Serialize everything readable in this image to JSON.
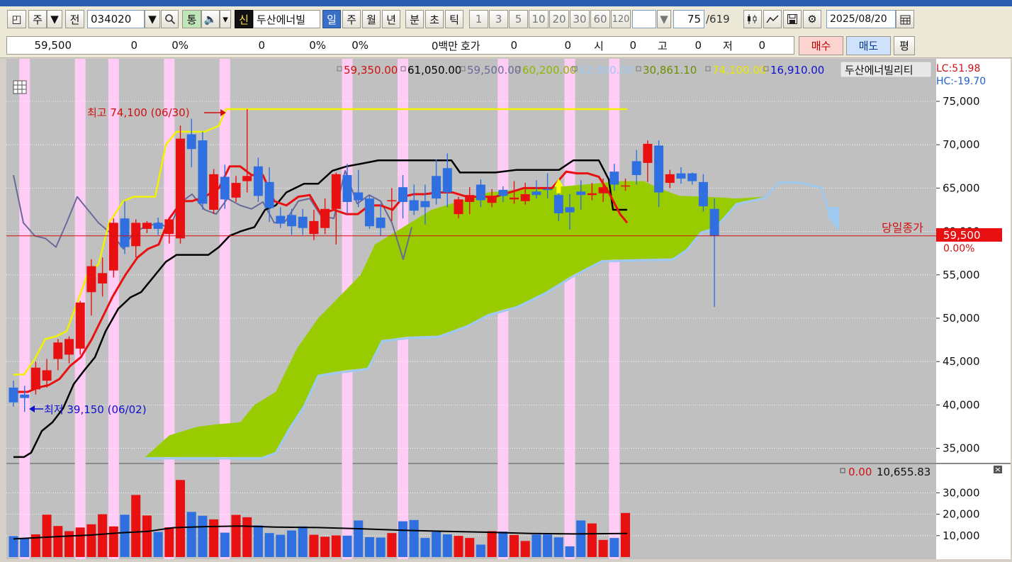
{
  "toolbar": {
    "period_unit": "주",
    "prev_label": "전",
    "stock_code": "034020",
    "ton_label": "통",
    "new_label": "신",
    "stock_name": "두산에너빌",
    "tabs": [
      "일",
      "주",
      "월",
      "년",
      "분",
      "초",
      "틱"
    ],
    "selected_tab": "일",
    "intervals": [
      "1",
      "3",
      "5",
      "10",
      "20",
      "30",
      "60",
      "120"
    ],
    "count_current": "75",
    "count_total": "/619",
    "date": "2025/08/20"
  },
  "quote": {
    "price": "59,500",
    "change": "0",
    "change_pct": "0%",
    "vol": "0",
    "vol_pct": "0%",
    "pct3": "0%",
    "amount": "0백만",
    "hoga_label": "호가",
    "hoga_val": "0",
    "val2": "0",
    "open_label": "시",
    "open_val": "0",
    "high_label": "고",
    "high_val": "0",
    "low_label": "저",
    "low_val": "0",
    "buy_label": "매수",
    "sell_label": "매도",
    "eval_label": "평"
  },
  "legend": {
    "items": [
      "59,350.00",
      "61,050.00",
      "59,500.00",
      "60,200.00",
      "62,800.00",
      "30,861.10",
      "74,100.00",
      "16,910.00"
    ],
    "colors": [
      "#d01010",
      "#000000",
      "#6a6a9a",
      "#8ab800",
      "#9ec9f0",
      "#6a8f00",
      "#e8e800",
      "#1010d0"
    ],
    "stock": "두산에너빌리티",
    "lc": "LC:51.98",
    "hc": "HC:-19.70"
  },
  "annotations": {
    "high": "최고 74,100 (06/30)",
    "low": "최저 39,150 (06/02)",
    "close_label": "당일종가",
    "close_price": "59,500",
    "close_pct": "0.00%"
  },
  "volume_legend": {
    "v1": "0.00",
    "v2": "10,655.83"
  },
  "colors": {
    "up": "#e81010",
    "down": "#2f6fe0",
    "highlight": "#ffccf5",
    "panel": "#c0c0c0",
    "cloud": "#99cc00"
  },
  "chart_data": [
    {
      "type": "candlestick",
      "series": [
        {
          "name": "price",
          "values": [
            {
              "o": 42,
              "h": 42.8,
              "l": 39.8,
              "c": 40.3
            },
            {
              "o": 41.2,
              "h": 42.2,
              "l": 39.2,
              "c": 40.8
            },
            {
              "o": 41.8,
              "h": 45,
              "l": 41.2,
              "c": 44.3
            },
            {
              "o": 42.8,
              "h": 45.3,
              "l": 42,
              "c": 44
            },
            {
              "o": 45.3,
              "h": 47.6,
              "l": 44,
              "c": 47.2
            },
            {
              "o": 45.8,
              "h": 47.9,
              "l": 44.8,
              "c": 47.6
            },
            {
              "o": 46.5,
              "h": 52,
              "l": 45.8,
              "c": 51.8
            },
            {
              "o": 53,
              "h": 56.8,
              "l": 50.3,
              "c": 56
            },
            {
              "o": 54,
              "h": 57,
              "l": 52.5,
              "c": 55.2
            },
            {
              "o": 55.5,
              "h": 61.5,
              "l": 54.7,
              "c": 61
            },
            {
              "o": 61.5,
              "h": 63.5,
              "l": 57.4,
              "c": 58.2
            },
            {
              "o": 58.3,
              "h": 61.4,
              "l": 57,
              "c": 61
            },
            {
              "o": 60.3,
              "h": 61.2,
              "l": 59.8,
              "c": 61
            },
            {
              "o": 61,
              "h": 61.6,
              "l": 59.6,
              "c": 60.3
            },
            {
              "o": 59.7,
              "h": 61.6,
              "l": 58.6,
              "c": 61.4
            },
            {
              "o": 59.2,
              "h": 72.2,
              "l": 58.6,
              "c": 70.7
            },
            {
              "o": 71.2,
              "h": 73,
              "l": 67.4,
              "c": 69.5
            },
            {
              "o": 70.5,
              "h": 71.5,
              "l": 62.5,
              "c": 63.2
            },
            {
              "o": 62.5,
              "h": 67.2,
              "l": 62,
              "c": 66.6
            },
            {
              "o": 66.3,
              "h": 67.7,
              "l": 62.6,
              "c": 63.7
            },
            {
              "o": 63.9,
              "h": 66.4,
              "l": 63.4,
              "c": 65.6
            },
            {
              "o": 65.8,
              "h": 74.1,
              "l": 64.5,
              "c": 66.4
            },
            {
              "o": 67.5,
              "h": 68.5,
              "l": 63.4,
              "c": 64.1
            },
            {
              "o": 65.7,
              "h": 67.4,
              "l": 61.1,
              "c": 62.7
            },
            {
              "o": 61.8,
              "h": 62.8,
              "l": 60.4,
              "c": 60.9
            },
            {
              "o": 61.9,
              "h": 62.6,
              "l": 59.6,
              "c": 60.6
            },
            {
              "o": 61.7,
              "h": 62.6,
              "l": 59.6,
              "c": 60.4
            },
            {
              "o": 59.7,
              "h": 62.5,
              "l": 59,
              "c": 61.2
            },
            {
              "o": 60.4,
              "h": 63.8,
              "l": 59.7,
              "c": 62.6
            },
            {
              "o": 62.6,
              "h": 66.8,
              "l": 58.5,
              "c": 66.6
            },
            {
              "o": 66.5,
              "h": 67.8,
              "l": 62,
              "c": 63.4
            },
            {
              "o": 64.5,
              "h": 67.1,
              "l": 62.8,
              "c": 63.6
            },
            {
              "o": 63.8,
              "h": 64.1,
              "l": 60.3,
              "c": 60.6
            },
            {
              "o": 61.6,
              "h": 63.2,
              "l": 59.5,
              "c": 60.4
            },
            {
              "o": 63.6,
              "h": 65,
              "l": 61.2,
              "c": 63.6
            },
            {
              "o": 65.1,
              "h": 66.5,
              "l": 61.5,
              "c": 63.4
            },
            {
              "o": 63.6,
              "h": 65.4,
              "l": 61.9,
              "c": 62.4
            },
            {
              "o": 63.5,
              "h": 65.4,
              "l": 60.8,
              "c": 62.8
            },
            {
              "o": 66.4,
              "h": 68.3,
              "l": 63.1,
              "c": 63.8
            },
            {
              "o": 67.3,
              "h": 69,
              "l": 62.8,
              "c": 64.5
            },
            {
              "o": 62,
              "h": 64,
              "l": 61.5,
              "c": 63.7
            },
            {
              "o": 63.4,
              "h": 65.1,
              "l": 62,
              "c": 64.2
            },
            {
              "o": 65.4,
              "h": 66,
              "l": 62.8,
              "c": 63.6
            },
            {
              "o": 63.3,
              "h": 64.9,
              "l": 62.8,
              "c": 64.1
            },
            {
              "o": 64.8,
              "h": 65.2,
              "l": 63.4,
              "c": 64.1
            },
            {
              "o": 63.7,
              "h": 65.8,
              "l": 63.2,
              "c": 63.9
            },
            {
              "o": 63.5,
              "h": 65.6,
              "l": 63.1,
              "c": 64.3
            },
            {
              "o": 64.6,
              "h": 65.9,
              "l": 63.8,
              "c": 64.2
            },
            {
              "o": 64.9,
              "h": 66.7,
              "l": 63.8,
              "c": 64.8
            },
            {
              "o": 64.2,
              "h": 65,
              "l": 61.2,
              "c": 62.1
            },
            {
              "o": 62.8,
              "h": 64.3,
              "l": 60.2,
              "c": 62.2
            },
            {
              "o": 64.6,
              "h": 65.9,
              "l": 62.5,
              "c": 64.2
            },
            {
              "o": 64.2,
              "h": 65.6,
              "l": 63.6,
              "c": 64.4
            },
            {
              "o": 64.4,
              "h": 66.1,
              "l": 63.4,
              "c": 65.1
            },
            {
              "o": 66.9,
              "h": 67.8,
              "l": 64.7,
              "c": 65.4
            },
            {
              "o": 65.2,
              "h": 66.1,
              "l": 64.7,
              "c": 65.3
            },
            {
              "o": 68.1,
              "h": 69.4,
              "l": 65.4,
              "c": 66.5
            },
            {
              "o": 67.9,
              "h": 70.5,
              "l": 65.7,
              "c": 70.1
            },
            {
              "o": 69.9,
              "h": 70.5,
              "l": 62.8,
              "c": 64.5
            },
            {
              "o": 65.6,
              "h": 67.1,
              "l": 65,
              "c": 66.6
            },
            {
              "o": 66.7,
              "h": 67.4,
              "l": 65.5,
              "c": 66.1
            },
            {
              "o": 66.7,
              "h": 66.8,
              "l": 65.4,
              "c": 65.8
            },
            {
              "o": 65.7,
              "h": 66.6,
              "l": 62.3,
              "c": 62.9
            },
            {
              "o": 62.6,
              "h": 63.8,
              "l": 51.3,
              "c": 59.5
            }
          ]
        }
      ]
    },
    {
      "type": "bar",
      "series": [
        {
          "name": "volume",
          "values": [
            9.8,
            8.8,
            10.6,
            19.8,
            14.5,
            12.1,
            13.8,
            15.3,
            20,
            14.3,
            19.8,
            29,
            19.4,
            11.7,
            13.9,
            36,
            21.1,
            19.3,
            17.6,
            11.4,
            19.7,
            18.6,
            14.8,
            11.2,
            10.4,
            12.4,
            14.3,
            10.4,
            9.5,
            10.1,
            10,
            17.1,
            9.3,
            9.1,
            11.2,
            16.7,
            17.3,
            8.9,
            11.8,
            10.6,
            9.9,
            8.9,
            5.8,
            12.1,
            11.9,
            10.3,
            7.5,
            10.5,
            10.5,
            9.2,
            5,
            17.1,
            15.7,
            8,
            8.9,
            20.6
          ]
        }
      ]
    }
  ]
}
